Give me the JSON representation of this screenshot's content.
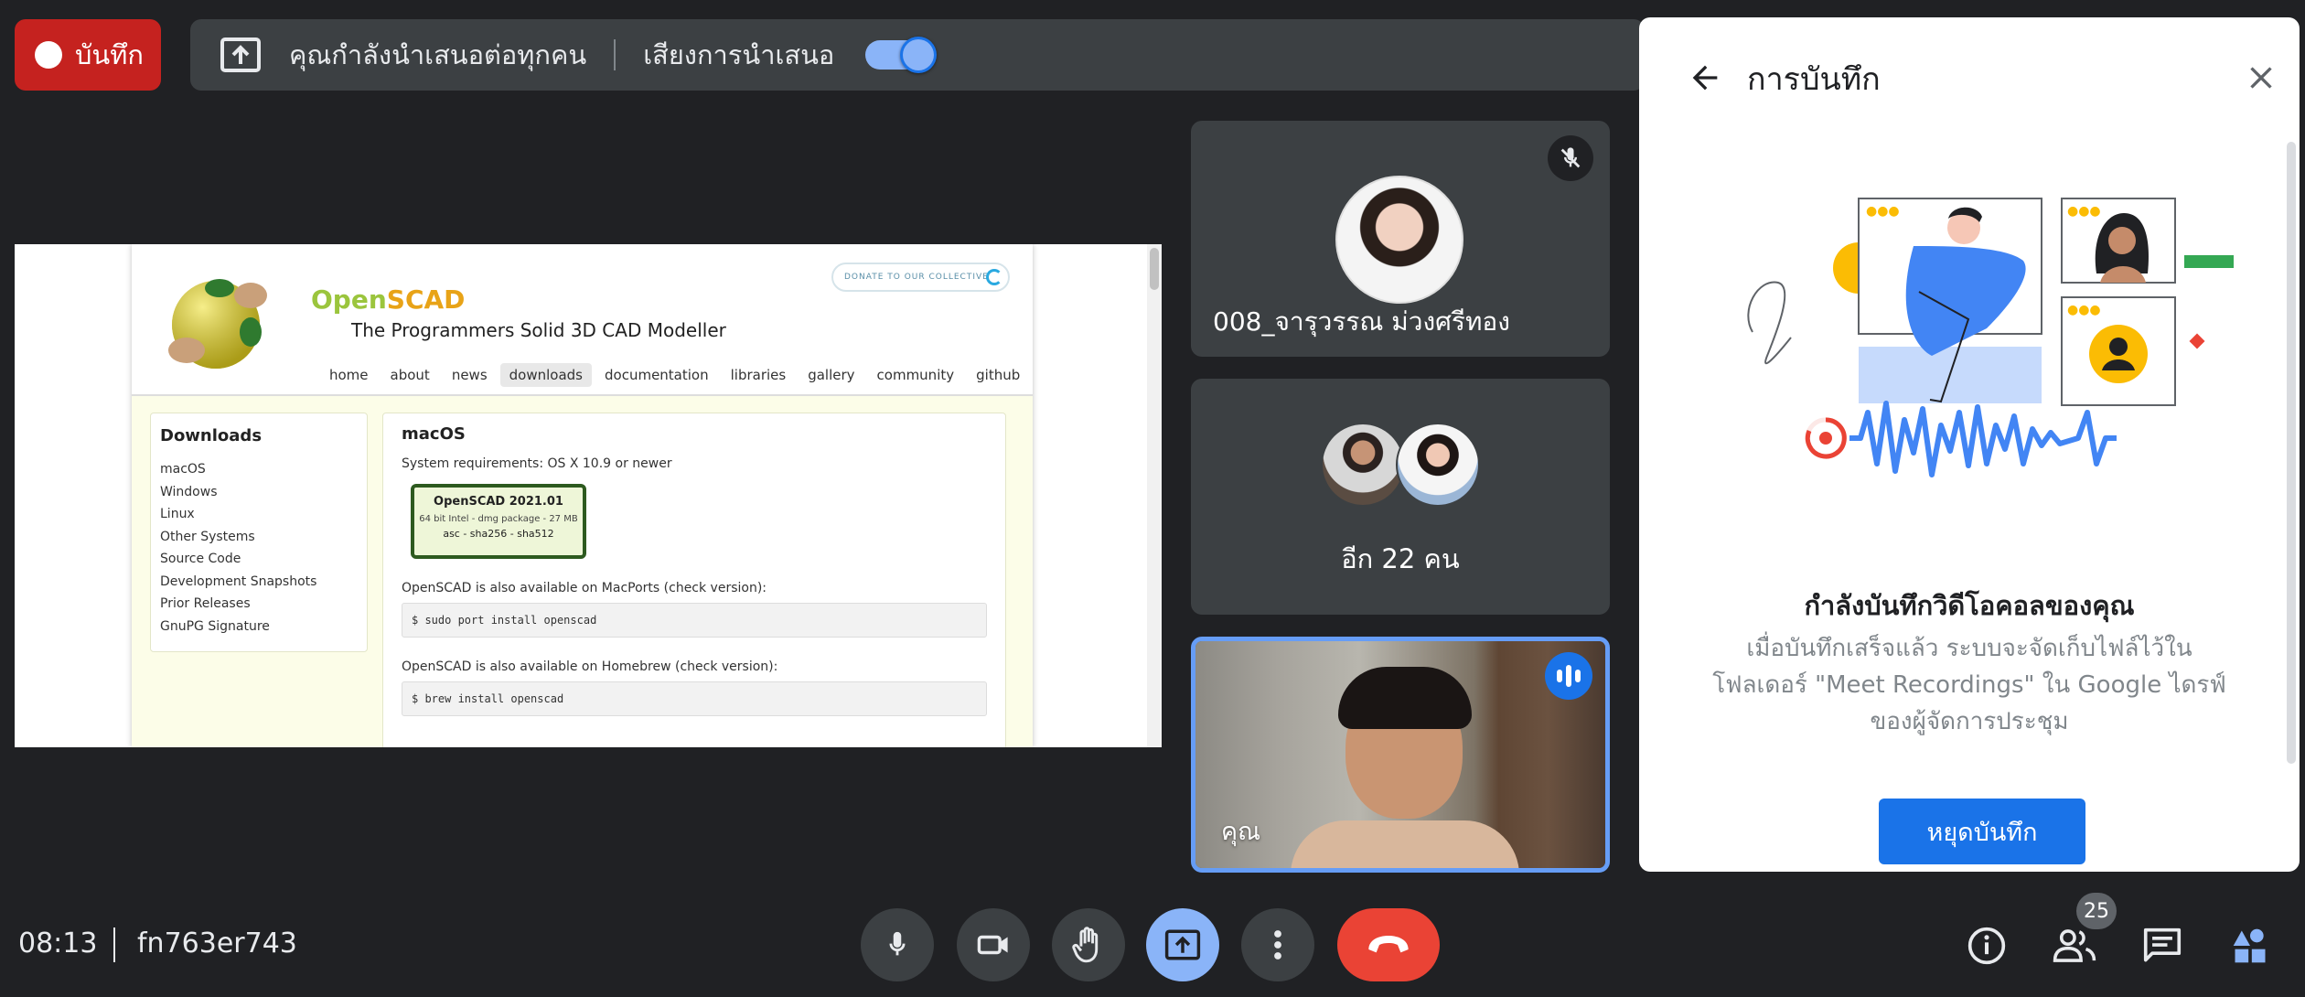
{
  "recording_pill": {
    "label": "บันทึก"
  },
  "presentation_bar": {
    "status_text": "คุณกำลังนำเสนอต่อทุกคน",
    "audio_label": "เสียงการนำเสนอ",
    "audio_enabled": true
  },
  "shared_screen": {
    "site_title_a": "Open",
    "site_title_b": "SCAD",
    "subtitle": "The Programmers Solid 3D CAD Modeller",
    "donate_label": "DONATE TO OUR COLLECTIVE",
    "nav": [
      "home",
      "about",
      "news",
      "downloads",
      "documentation",
      "libraries",
      "gallery",
      "community",
      "github"
    ],
    "nav_active": "downloads",
    "sidebar_heading": "Downloads",
    "sidebar_items": [
      "macOS",
      "Windows",
      "Linux",
      "Other Systems",
      "Source Code",
      "Development Snapshots",
      "Prior Releases",
      "GnuPG Signature"
    ],
    "main_heading": "macOS",
    "requirements": "System requirements: OS X 10.9 or newer",
    "download_box": {
      "title": "OpenSCAD 2021.01",
      "detail": "64 bit Intel - dmg package - 27 MB",
      "hashes": "asc - sha256 - sha512"
    },
    "macports_text": "OpenSCAD is also available on MacPorts (check version):",
    "macports_cmd": "$ sudo port install openscad",
    "homebrew_text": "OpenSCAD is also available on Homebrew (check version):",
    "homebrew_cmd": "$ brew install openscad"
  },
  "participants": {
    "tile1_name": "008_จารุวรรณ ม่วงศรีทอง",
    "tile2_label": "อีก 22 คน",
    "tile3_name": "คุณ"
  },
  "recording_panel": {
    "title": "การบันทึก",
    "heading": "กำลังบันทึกวิดีโอคอลของคุณ",
    "description": "เมื่อบันทึกเสร็จแล้ว ระบบจะจัดเก็บไฟล์ไว้ใน โฟลเดอร์ \"Meet Recordings\" ใน Google ไดรฟ์ของผู้จัดการประชุม",
    "stop_button": "หยุดบันทึก"
  },
  "bottom_bar": {
    "time": "08:13",
    "meeting_code": "fn763er743",
    "participant_count": "25"
  },
  "colors": {
    "background": "#202124",
    "recording_red": "#c5221f",
    "accent_blue": "#1a73e8",
    "end_call_red": "#ea4335"
  }
}
